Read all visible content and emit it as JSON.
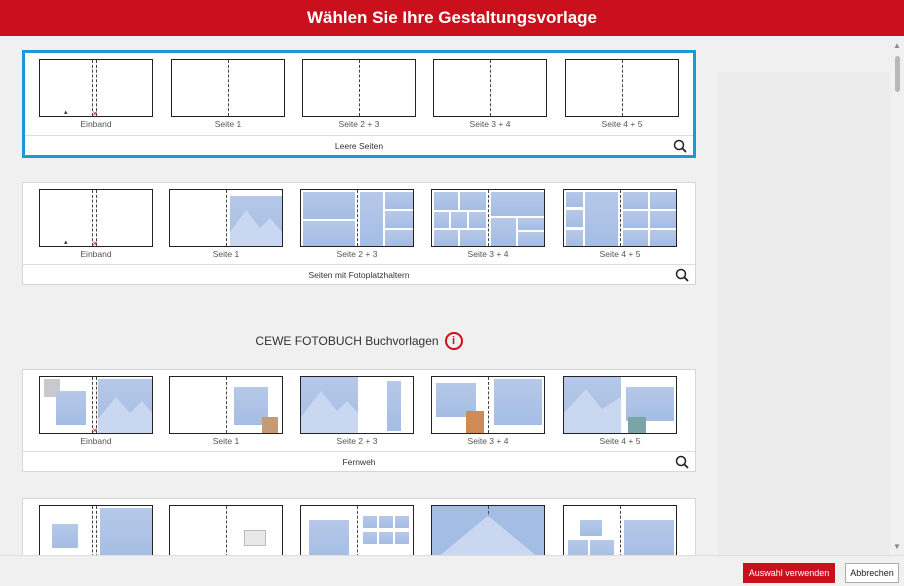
{
  "header": {
    "title": "Wählen Sie Ihre Gestaltungsvorlage"
  },
  "colors": {
    "brand_red": "#c9101c",
    "selection_blue": "#1f97d6",
    "photo_placeholder": "#a4bde4"
  },
  "templates": [
    {
      "name": "Leere Seiten",
      "selected": true,
      "pages": [
        "Einband",
        "Seite 1",
        "Seite 2 + 3",
        "Seite 3 + 4",
        "Seite 4 + 5"
      ]
    },
    {
      "name": "Seiten mit Fotoplatzhaltern",
      "selected": false,
      "pages": [
        "Einband",
        "Seite 1",
        "Seite 2 + 3",
        "Seite 3 + 4",
        "Seite 4 + 5"
      ]
    },
    {
      "name": "Fernweh",
      "selected": false,
      "pages": [
        "Einband",
        "Seite 1",
        "Seite 2 + 3",
        "Seite 3 + 4",
        "Seite 4 + 5"
      ]
    }
  ],
  "section": {
    "title": "CEWE FOTOBUCH Buchvorlagen",
    "info_icon": "info-icon"
  },
  "icons": {
    "zoom": "magnifier-icon"
  },
  "buttons": {
    "use_selection": "Auswahl verwenden",
    "cancel": "Abbrechen"
  }
}
